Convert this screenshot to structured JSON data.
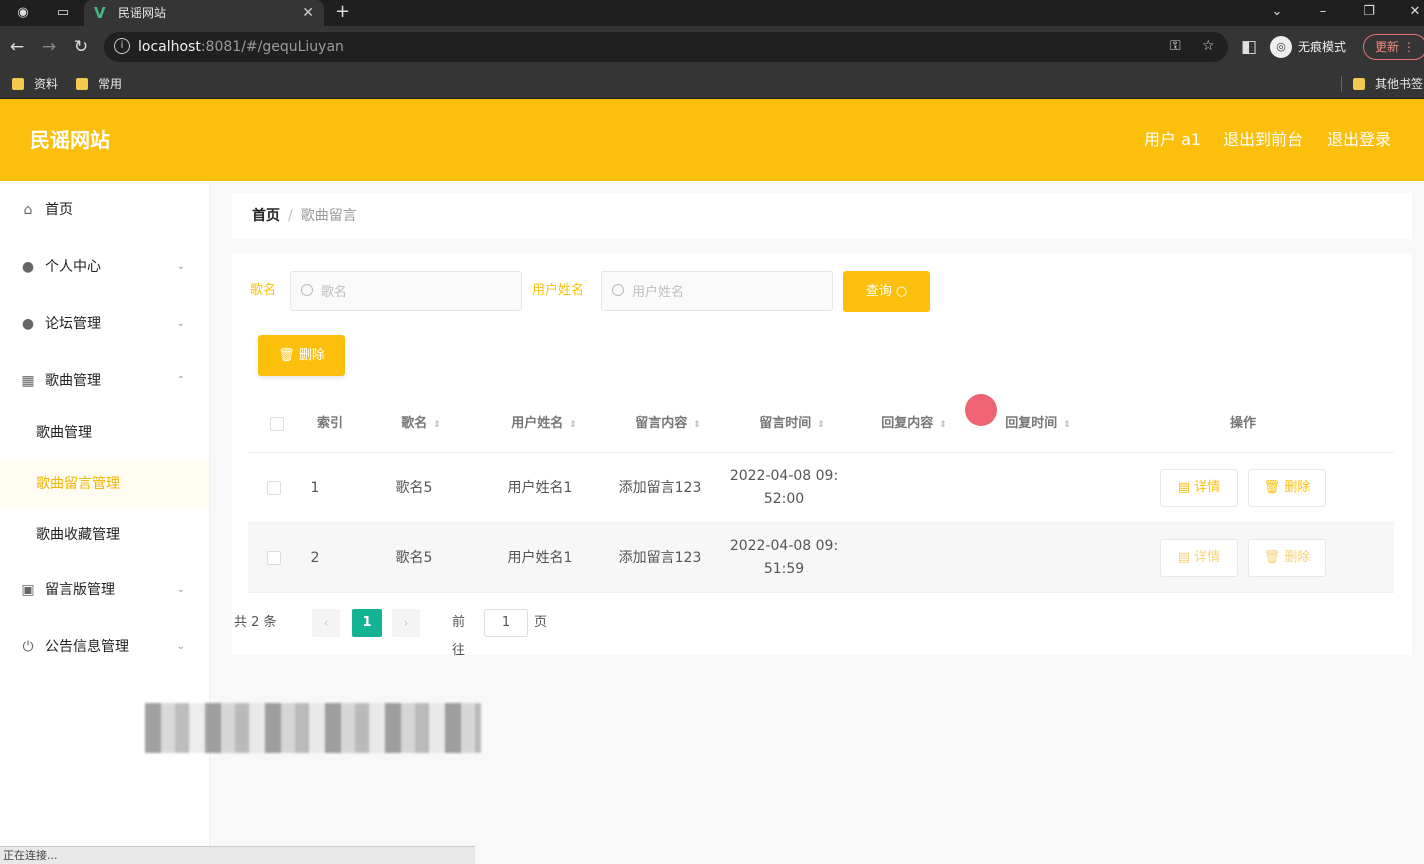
{
  "browser": {
    "tab_title": "民谣网站",
    "url_host": "localhost",
    "url_rest": ":8081/#/gequLiuyan",
    "incognito_label": "无痕模式",
    "update_label": "更新",
    "bookmarks": [
      "资料",
      "常用"
    ],
    "other_bookmarks": "其他书签",
    "status_text": "正在连接..."
  },
  "header": {
    "brand": "民谣网站",
    "user": "用户 a1",
    "exit_front": "退出到前台",
    "logout": "退出登录"
  },
  "sidebar": {
    "items": [
      {
        "label": "首页",
        "icon": "home-icon"
      },
      {
        "label": "个人中心",
        "icon": "user-icon"
      },
      {
        "label": "论坛管理",
        "icon": "bulb-icon"
      },
      {
        "label": "歌曲管理",
        "icon": "grid-icon"
      }
    ],
    "subitems": [
      "歌曲管理",
      "歌曲留言管理",
      "歌曲收藏管理"
    ],
    "items_after": [
      {
        "label": "留言版管理",
        "icon": "clipboard-icon"
      },
      {
        "label": "公告信息管理",
        "icon": "power-icon"
      }
    ]
  },
  "breadcrumb": {
    "home": "首页",
    "separator": "/",
    "current": "歌曲留言"
  },
  "search": {
    "song_label": "歌名",
    "song_placeholder": "歌名",
    "user_label": "用户姓名",
    "user_placeholder": "用户姓名",
    "query_button": "查询"
  },
  "toolbar": {
    "delete_button": "删除"
  },
  "table": {
    "columns": [
      "索引",
      "歌名",
      "用户姓名",
      "留言内容",
      "留言时间",
      "回复内容",
      "回复时间",
      "操作"
    ],
    "rows": [
      {
        "index": "1",
        "song": "歌名5",
        "user": "用户姓名1",
        "content": "添加留言123",
        "time_line1": "2022-04-08 09:",
        "time_line2": "52:00",
        "reply": "",
        "reply_time": ""
      },
      {
        "index": "2",
        "song": "歌名5",
        "user": "用户姓名1",
        "content": "添加留言123",
        "time_line1": "2022-04-08 09:",
        "time_line2": "51:59",
        "reply": "",
        "reply_time": ""
      }
    ],
    "detail_label": "详情",
    "delete_label": "删除"
  },
  "pagination": {
    "total": "共 2 条",
    "current_page": "1",
    "goto_label": "前往",
    "goto_value": "1",
    "page_suffix": "页"
  },
  "colors": {
    "accent": "#fbbf0c",
    "page_active": "#13b394"
  }
}
